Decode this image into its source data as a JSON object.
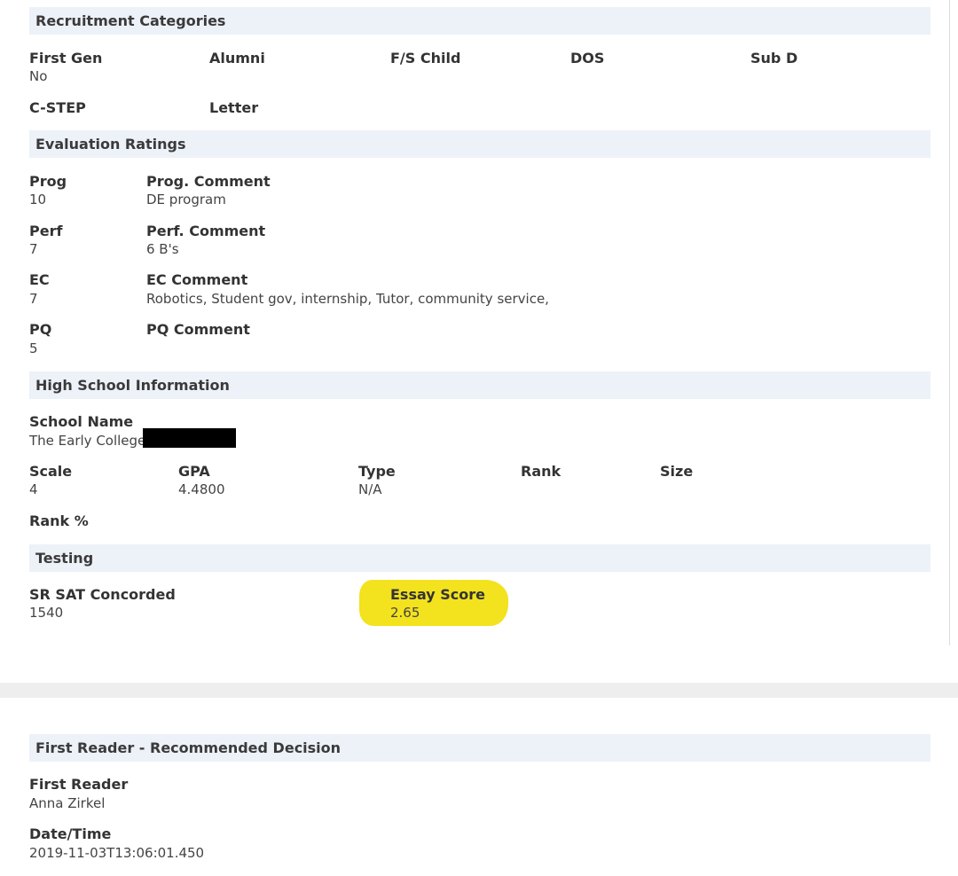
{
  "recruitment": {
    "header": "Recruitment Categories",
    "first_gen_label": "First Gen",
    "first_gen_value": "No",
    "alumni_label": "Alumni",
    "fs_child_label": "F/S Child",
    "dos_label": "DOS",
    "sub_d_label": "Sub D",
    "cstep_label": "C-STEP",
    "letter_label": "Letter"
  },
  "evaluation": {
    "header": "Evaluation Ratings",
    "prog_label": "Prog",
    "prog_value": "10",
    "prog_comment_label": "Prog. Comment",
    "prog_comment_value": "DE program",
    "perf_label": "Perf",
    "perf_value": "7",
    "perf_comment_label": "Perf. Comment",
    "perf_comment_value": "6 B's",
    "ec_label": "EC",
    "ec_value": "7",
    "ec_comment_label": "EC Comment",
    "ec_comment_value": "Robotics, Student gov, internship, Tutor, community service,",
    "pq_label": "PQ",
    "pq_value": "5",
    "pq_comment_label": "PQ Comment"
  },
  "high_school": {
    "header": "High School Information",
    "school_name_label": "School Name",
    "school_name_value": "The Early College",
    "scale_label": "Scale",
    "scale_value": "4",
    "gpa_label": "GPA",
    "gpa_value": "4.4800",
    "type_label": "Type",
    "type_value": "N/A",
    "rank_label": "Rank",
    "size_label": "Size",
    "rank_pct_label": "Rank %"
  },
  "testing": {
    "header": "Testing",
    "sat_label": "SR SAT Concorded",
    "sat_value": "1540",
    "essay_label": "Essay Score",
    "essay_value": "2.65"
  },
  "first_reader": {
    "header": "First Reader - Recommended Decision",
    "reader_label": "First Reader",
    "reader_value": "Anna Zirkel",
    "datetime_label": "Date/Time",
    "datetime_value": "2019-11-03T13:06:01.450"
  },
  "colors": {
    "header_bg": "#edf1f8",
    "highlight": "#f3e21e",
    "redaction": "#000000"
  }
}
